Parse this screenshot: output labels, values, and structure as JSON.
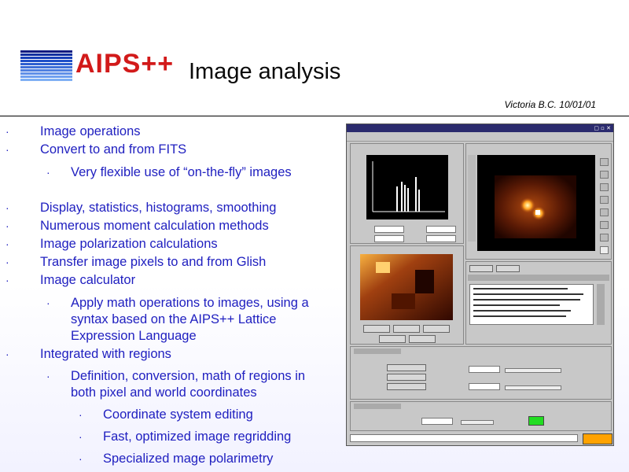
{
  "header": {
    "logo_text": "AIPS++",
    "title": "Image  analysis",
    "meta": "Victoria  B.C.  10/01/01"
  },
  "bullets": [
    {
      "level": 1,
      "text": "Image  operations"
    },
    {
      "level": 1,
      "text": "Convert  to  and  from  FITS"
    },
    {
      "level": 2,
      "text": "Very  flexible  use  of  “on-the-fly”  images"
    },
    {
      "level": 1,
      "text": "Display,  statistics,  histograms,  smoothing"
    },
    {
      "level": 1,
      "text": "Numerous  moment  calculation  methods"
    },
    {
      "level": 1,
      "text": "Image  polarization  calculations"
    },
    {
      "level": 1,
      "text": "Transfer  image  pixels  to  and  from  Glish"
    },
    {
      "level": 1,
      "text": "Image  calculator"
    },
    {
      "level": 2,
      "text": "Apply  math  operations  to  images,  using  a  syntax  based  on  the  AIPS++  Lattice  Expression  Language"
    },
    {
      "level": 1,
      "text": "Integrated  with  regions"
    },
    {
      "level": 2,
      "text": "Definition,  conversion,  math  of  regions  in  both  pixel  and  world  coordinates"
    },
    {
      "level": 3,
      "text": "Coordinate  system  editing"
    },
    {
      "level": 3,
      "text": "Fast,  optimized  image  regridding"
    },
    {
      "level": 3,
      "text": "Specialized  mage  polarimetry"
    }
  ],
  "colors": {
    "bullet_text": "#2020c0",
    "logo_red": "#d21a1a",
    "logo_blue": "#1a3fd0"
  }
}
